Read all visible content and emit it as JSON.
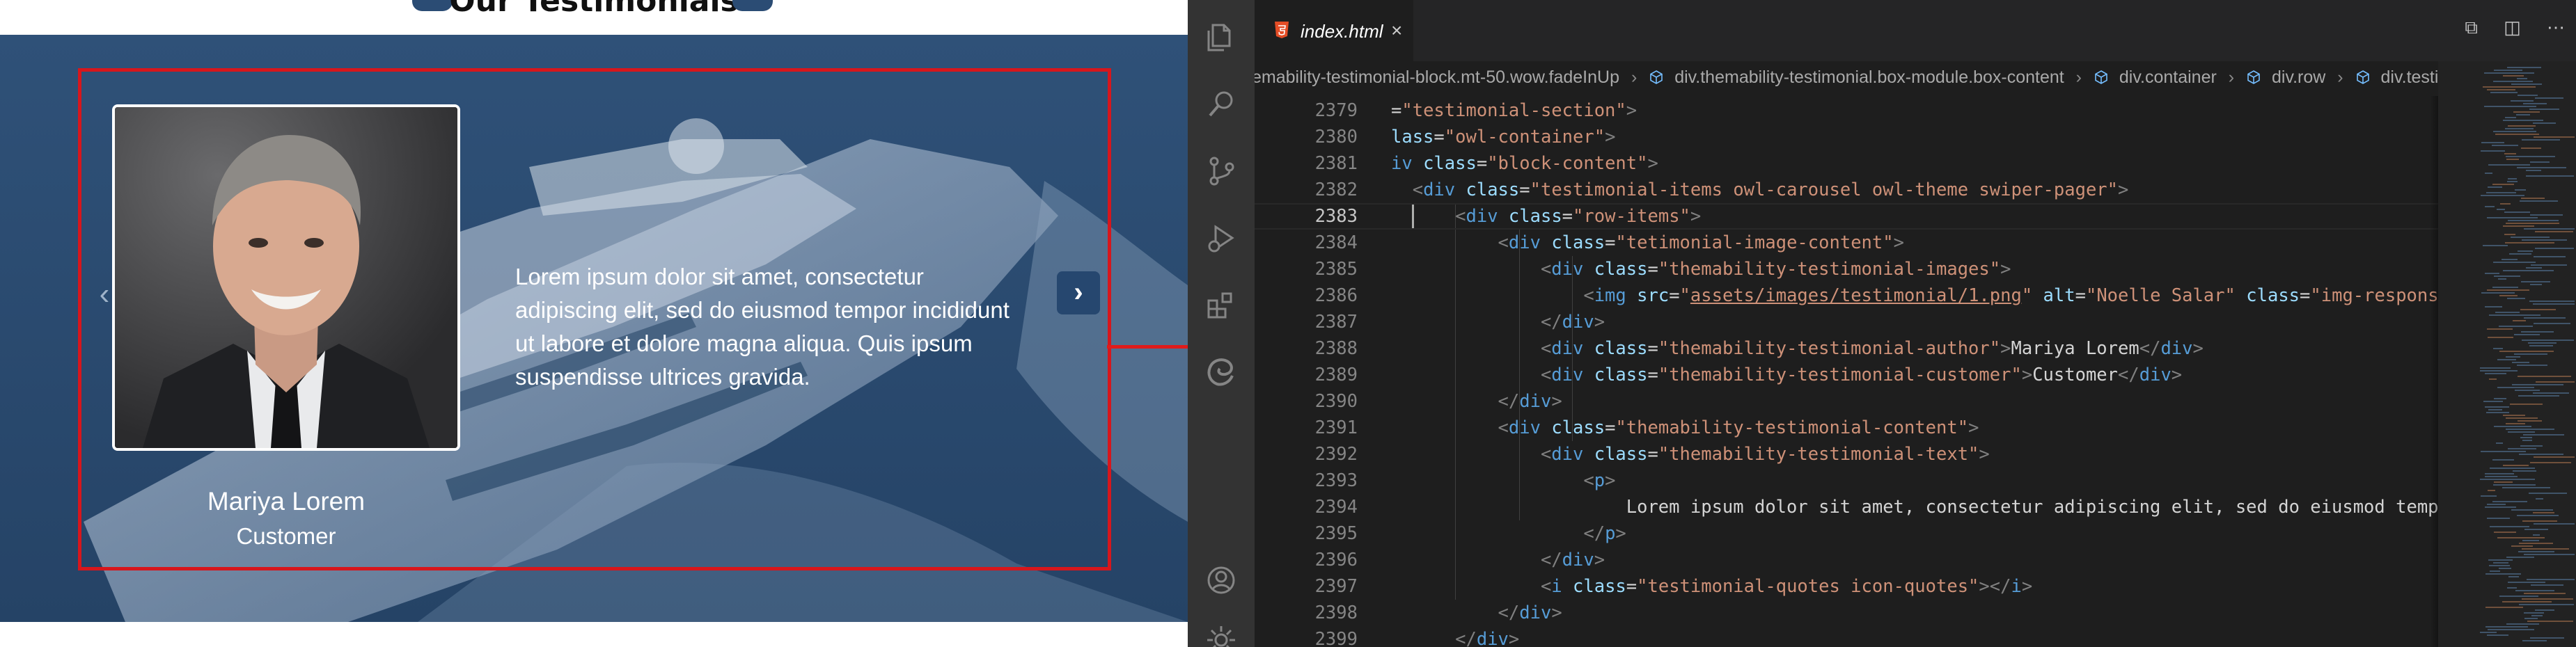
{
  "website": {
    "section_title": "Our Testimonials",
    "testimonial": {
      "author": "Mariya Lorem",
      "role": "Customer",
      "quote_lines": [
        "Lorem ipsum dolor sit amet, consectetur",
        "adipiscing elit, sed do eiusmod tempor incididunt",
        "ut labore et dolore magna aliqua. Quis ipsum",
        "suspendisse ultrices gravida."
      ]
    },
    "nav": {
      "prev": "‹",
      "next": "›"
    },
    "colors": {
      "hero_bg": "#2b4b70",
      "highlight": "#d7161c",
      "arrow": "#e01b1b"
    }
  },
  "editor": {
    "tab": {
      "label": "index.html",
      "close": "×",
      "icon": "html5-icon"
    },
    "actions": [
      "split-editor-icon",
      "layout-icon",
      "more-icon"
    ],
    "action_glyphs": [
      "⧉",
      "◫",
      "⋯"
    ],
    "breadcrumbs": [
      "emability-testimonial-block.mt-50.wow.fadeInUp",
      "div.themability-testimonial.box-module.box-content",
      "div.container",
      "div.row",
      "div.testimonial-sec"
    ],
    "active_line": 2383,
    "lines": [
      {
        "num": "2379",
        "tokens": [
          {
            "t": "=",
            "c": "t-text"
          },
          {
            "t": "\"testimonial-section\"",
            "c": "t-str"
          },
          {
            "t": ">",
            "c": "t-punc"
          }
        ]
      },
      {
        "num": "2380",
        "tokens": [
          {
            "t": "lass",
            "c": "t-attr"
          },
          {
            "t": "=",
            "c": "t-text"
          },
          {
            "t": "\"owl-container\"",
            "c": "t-str"
          },
          {
            "t": ">",
            "c": "t-punc"
          }
        ]
      },
      {
        "num": "2381",
        "tokens": [
          {
            "t": "iv ",
            "c": "t-tag"
          },
          {
            "t": "class",
            "c": "t-attr"
          },
          {
            "t": "=",
            "c": "t-text"
          },
          {
            "t": "\"block-content\"",
            "c": "t-str"
          },
          {
            "t": ">",
            "c": "t-punc"
          }
        ]
      },
      {
        "num": "2382",
        "tokens": [
          {
            "t": "  ",
            "c": "t-text"
          },
          {
            "t": "<",
            "c": "t-punc"
          },
          {
            "t": "div ",
            "c": "t-tag"
          },
          {
            "t": "class",
            "c": "t-attr"
          },
          {
            "t": "=",
            "c": "t-text"
          },
          {
            "t": "\"testimonial-items owl-carousel owl-theme swiper-pager\"",
            "c": "t-str"
          },
          {
            "t": ">",
            "c": "t-punc"
          }
        ]
      },
      {
        "num": "2383",
        "tokens": [
          {
            "t": "      ",
            "c": "t-text"
          },
          {
            "t": "<",
            "c": "t-punc"
          },
          {
            "t": "div ",
            "c": "t-tag"
          },
          {
            "t": "class",
            "c": "t-attr"
          },
          {
            "t": "=",
            "c": "t-text"
          },
          {
            "t": "\"row-items\"",
            "c": "t-str"
          },
          {
            "t": ">",
            "c": "t-punc"
          }
        ]
      },
      {
        "num": "2384",
        "tokens": [
          {
            "t": "          ",
            "c": "t-text"
          },
          {
            "t": "<",
            "c": "t-punc"
          },
          {
            "t": "div ",
            "c": "t-tag"
          },
          {
            "t": "class",
            "c": "t-attr"
          },
          {
            "t": "=",
            "c": "t-text"
          },
          {
            "t": "\"tetimonial-image-content\"",
            "c": "t-str"
          },
          {
            "t": ">",
            "c": "t-punc"
          }
        ]
      },
      {
        "num": "2385",
        "tokens": [
          {
            "t": "              ",
            "c": "t-text"
          },
          {
            "t": "<",
            "c": "t-punc"
          },
          {
            "t": "div ",
            "c": "t-tag"
          },
          {
            "t": "class",
            "c": "t-attr"
          },
          {
            "t": "=",
            "c": "t-text"
          },
          {
            "t": "\"themability-testimonial-images\"",
            "c": "t-str"
          },
          {
            "t": ">",
            "c": "t-punc"
          }
        ]
      },
      {
        "num": "2386",
        "tokens": [
          {
            "t": "                  ",
            "c": "t-text"
          },
          {
            "t": "<",
            "c": "t-punc"
          },
          {
            "t": "img ",
            "c": "t-tag"
          },
          {
            "t": "src",
            "c": "t-attr"
          },
          {
            "t": "=",
            "c": "t-text"
          },
          {
            "t": "\"",
            "c": "t-str"
          },
          {
            "t": "assets/images/testimonial/1.png",
            "c": "t-link"
          },
          {
            "t": "\" ",
            "c": "t-str"
          },
          {
            "t": "alt",
            "c": "t-attr"
          },
          {
            "t": "=",
            "c": "t-text"
          },
          {
            "t": "\"Noelle Salar\" ",
            "c": "t-str"
          },
          {
            "t": "class",
            "c": "t-attr"
          },
          {
            "t": "=",
            "c": "t-text"
          },
          {
            "t": "\"img-responsive",
            "c": "t-str"
          }
        ]
      },
      {
        "num": "2387",
        "tokens": [
          {
            "t": "              ",
            "c": "t-text"
          },
          {
            "t": "</",
            "c": "t-punc"
          },
          {
            "t": "div",
            "c": "t-tag"
          },
          {
            "t": ">",
            "c": "t-punc"
          }
        ]
      },
      {
        "num": "2388",
        "tokens": [
          {
            "t": "              ",
            "c": "t-text"
          },
          {
            "t": "<",
            "c": "t-punc"
          },
          {
            "t": "div ",
            "c": "t-tag"
          },
          {
            "t": "class",
            "c": "t-attr"
          },
          {
            "t": "=",
            "c": "t-text"
          },
          {
            "t": "\"themability-testimonial-author\"",
            "c": "t-str"
          },
          {
            "t": ">",
            "c": "t-punc"
          },
          {
            "t": "Mariya Lorem",
            "c": "t-text"
          },
          {
            "t": "</",
            "c": "t-punc"
          },
          {
            "t": "div",
            "c": "t-tag"
          },
          {
            "t": ">",
            "c": "t-punc"
          }
        ]
      },
      {
        "num": "2389",
        "tokens": [
          {
            "t": "              ",
            "c": "t-text"
          },
          {
            "t": "<",
            "c": "t-punc"
          },
          {
            "t": "div ",
            "c": "t-tag"
          },
          {
            "t": "class",
            "c": "t-attr"
          },
          {
            "t": "=",
            "c": "t-text"
          },
          {
            "t": "\"themability-testimonial-customer\"",
            "c": "t-str"
          },
          {
            "t": ">",
            "c": "t-punc"
          },
          {
            "t": "Customer",
            "c": "t-text"
          },
          {
            "t": "</",
            "c": "t-punc"
          },
          {
            "t": "div",
            "c": "t-tag"
          },
          {
            "t": ">",
            "c": "t-punc"
          }
        ]
      },
      {
        "num": "2390",
        "tokens": [
          {
            "t": "          ",
            "c": "t-text"
          },
          {
            "t": "</",
            "c": "t-punc"
          },
          {
            "t": "div",
            "c": "t-tag"
          },
          {
            "t": ">",
            "c": "t-punc"
          }
        ]
      },
      {
        "num": "2391",
        "tokens": [
          {
            "t": "          ",
            "c": "t-text"
          },
          {
            "t": "<",
            "c": "t-punc"
          },
          {
            "t": "div ",
            "c": "t-tag"
          },
          {
            "t": "class",
            "c": "t-attr"
          },
          {
            "t": "=",
            "c": "t-text"
          },
          {
            "t": "\"themability-testimonial-content\"",
            "c": "t-str"
          },
          {
            "t": ">",
            "c": "t-punc"
          }
        ]
      },
      {
        "num": "2392",
        "tokens": [
          {
            "t": "              ",
            "c": "t-text"
          },
          {
            "t": "<",
            "c": "t-punc"
          },
          {
            "t": "div ",
            "c": "t-tag"
          },
          {
            "t": "class",
            "c": "t-attr"
          },
          {
            "t": "=",
            "c": "t-text"
          },
          {
            "t": "\"themability-testimonial-text\"",
            "c": "t-str"
          },
          {
            "t": ">",
            "c": "t-punc"
          }
        ]
      },
      {
        "num": "2393",
        "tokens": [
          {
            "t": "                  ",
            "c": "t-text"
          },
          {
            "t": "<",
            "c": "t-punc"
          },
          {
            "t": "p",
            "c": "t-tag"
          },
          {
            "t": ">",
            "c": "t-punc"
          }
        ]
      },
      {
        "num": "2394",
        "tokens": [
          {
            "t": "                      Lorem ipsum dolor sit amet, consectetur adipiscing elit, sed do eiusmod tempor",
            "c": "t-text"
          }
        ]
      },
      {
        "num": "2395",
        "tokens": [
          {
            "t": "                  ",
            "c": "t-text"
          },
          {
            "t": "</",
            "c": "t-punc"
          },
          {
            "t": "p",
            "c": "t-tag"
          },
          {
            "t": ">",
            "c": "t-punc"
          }
        ]
      },
      {
        "num": "2396",
        "tokens": [
          {
            "t": "              ",
            "c": "t-text"
          },
          {
            "t": "</",
            "c": "t-punc"
          },
          {
            "t": "div",
            "c": "t-tag"
          },
          {
            "t": ">",
            "c": "t-punc"
          }
        ]
      },
      {
        "num": "2397",
        "tokens": [
          {
            "t": "              ",
            "c": "t-text"
          },
          {
            "t": "<",
            "c": "t-punc"
          },
          {
            "t": "i ",
            "c": "t-tag"
          },
          {
            "t": "class",
            "c": "t-attr"
          },
          {
            "t": "=",
            "c": "t-text"
          },
          {
            "t": "\"testimonial-quotes icon-quotes\"",
            "c": "t-str"
          },
          {
            "t": "></",
            "c": "t-punc"
          },
          {
            "t": "i",
            "c": "t-tag"
          },
          {
            "t": ">",
            "c": "t-punc"
          }
        ]
      },
      {
        "num": "2398",
        "tokens": [
          {
            "t": "          ",
            "c": "t-text"
          },
          {
            "t": "</",
            "c": "t-punc"
          },
          {
            "t": "div",
            "c": "t-tag"
          },
          {
            "t": ">",
            "c": "t-punc"
          }
        ]
      },
      {
        "num": "2399",
        "tokens": [
          {
            "t": "      ",
            "c": "t-text"
          },
          {
            "t": "</",
            "c": "t-punc"
          },
          {
            "t": "div",
            "c": "t-tag"
          },
          {
            "t": ">",
            "c": "t-punc"
          }
        ]
      }
    ],
    "activity_icons": [
      "explorer-icon",
      "search-icon",
      "source-control-icon",
      "run-debug-icon",
      "extensions-icon",
      "edge-tools-icon",
      "account-icon",
      "settings-icon"
    ]
  }
}
